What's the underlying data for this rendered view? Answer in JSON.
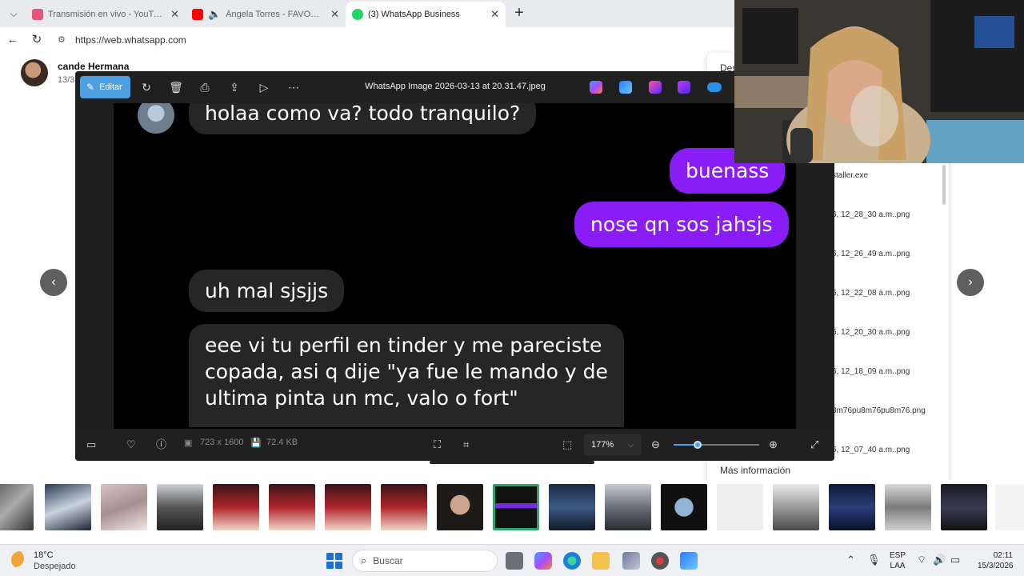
{
  "browser": {
    "tabs": [
      {
        "label": "Transmisión en vivo - YouTube Studio",
        "icon": "youtube-studio-icon",
        "color": "#e5547a"
      },
      {
        "label": "Ángela Torres - FAVORITA (Official Video)",
        "icon": "youtube-icon",
        "color": "#ff0000"
      },
      {
        "label": "(3) WhatsApp Business",
        "icon": "whatsapp-icon",
        "color": "#25d366"
      }
    ],
    "url": "https://web.whatsapp.com"
  },
  "chat": {
    "contact_name": "cande Hermana",
    "contact_date": "13/3"
  },
  "viewer": {
    "edit_label": "Editar",
    "file_title": "WhatsApp Image 2026-03-13 at 20.31.47.jpeg",
    "dimensions": "723 x 1600",
    "file_size": "72.4 KB",
    "zoom": "177%",
    "zoom_fraction": 0.28,
    "accent": "#4c9fe0",
    "image_messages": {
      "top_partial": "holaa como va? todo tranquilo?",
      "out_1": "buenass",
      "out_2": "nose qn sos jahsjs",
      "in_1": "uh mal sjsjjs",
      "in_2_lines": [
        "eee vi tu perfil en tinder y me pareciste",
        "copada, asi q dije \"ya fue le mando y de",
        "ultima pinta un mc, valo o fort\""
      ]
    }
  },
  "downloads": {
    "header": "Des",
    "items": [
      "staller.exe",
      "6, 12_28_30 a.m..png",
      "6, 12_26_49 a.m..png",
      "6, 12_22_08 a.m..png",
      "6, 12_20_30 a.m..png",
      "6, 12_18_09 a.m..png",
      "8m76pu8m76pu8m76.png",
      "6, 12_07_40 a.m..png"
    ],
    "more_label": "Más información"
  },
  "taskbar": {
    "temperature": "18°C",
    "condition": "Despejado",
    "search_placeholder": "Buscar",
    "lang_line1": "ESP",
    "lang_line2": "LAA",
    "time": "02:11",
    "date": "15/3/2026"
  }
}
